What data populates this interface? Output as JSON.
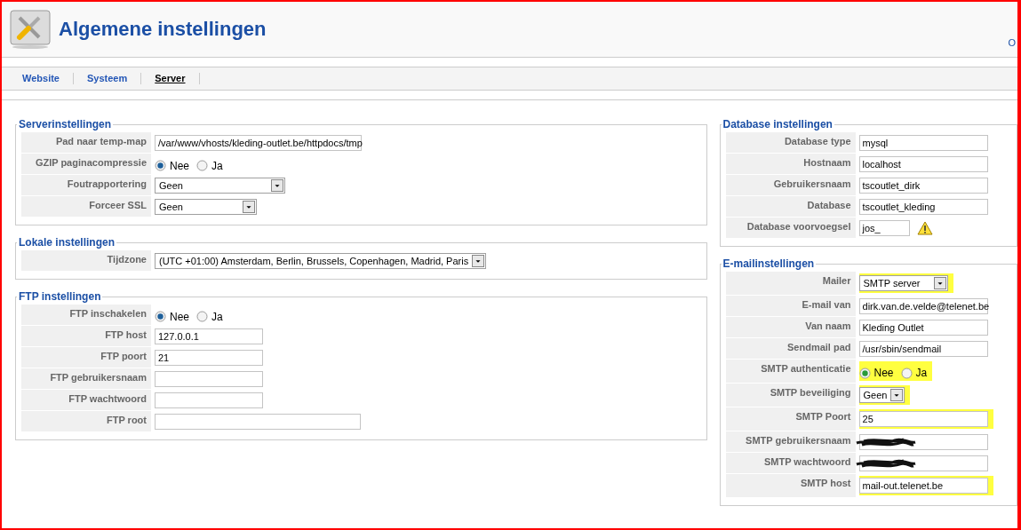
{
  "header": {
    "title": "Algemene instellingen",
    "toolbar_text": "O"
  },
  "tabs": [
    {
      "label": "Website",
      "selected": false
    },
    {
      "label": "Systeem",
      "selected": false
    },
    {
      "label": "Server",
      "selected": true
    }
  ],
  "left_sections": [
    {
      "title": "Serverinstellingen",
      "rows": [
        {
          "label": "Pad naar temp-map",
          "kind": "text",
          "value": "/var/www/vhosts/kleding-outlet.be/httpdocs/tmp"
        },
        {
          "label": "GZIP paginacompressie",
          "kind": "radio",
          "options": [
            {
              "label": "Nee",
              "selected": true
            },
            {
              "label": "Ja",
              "selected": false
            }
          ]
        },
        {
          "label": "Foutrapportering",
          "kind": "select",
          "value": "Geen"
        },
        {
          "label": "Forceer SSL",
          "kind": "select",
          "value": "Geen"
        }
      ]
    },
    {
      "title": "Lokale instellingen",
      "rows": [
        {
          "label": "Tijdzone",
          "kind": "select",
          "value": "(UTC +01:00) Amsterdam, Berlin, Brussels, Copenhagen, Madrid, Paris"
        }
      ]
    },
    {
      "title": "FTP instellingen",
      "rows": [
        {
          "label": "FTP inschakelen",
          "kind": "radio",
          "options": [
            {
              "label": "Nee",
              "selected": true
            },
            {
              "label": "Ja",
              "selected": false
            }
          ]
        },
        {
          "label": "FTP host",
          "kind": "text",
          "value": "127.0.0.1"
        },
        {
          "label": "FTP poort",
          "kind": "text",
          "value": "21"
        },
        {
          "label": "FTP gebruikersnaam",
          "kind": "text"
        },
        {
          "label": "FTP wachtwoord",
          "kind": "text"
        },
        {
          "label": "FTP root",
          "kind": "text"
        }
      ]
    }
  ],
  "right_sections": [
    {
      "title": "Database instellingen",
      "rows": [
        {
          "label": "Database type",
          "kind": "text",
          "value": "mysql"
        },
        {
          "label": "Hostnaam",
          "kind": "text",
          "value": "localhost"
        },
        {
          "label": "Gebruikersnaam",
          "kind": "text",
          "value": "tscoutlet_dirk"
        },
        {
          "label": "Database",
          "kind": "text",
          "value": "tscoutlet_kleding"
        },
        {
          "label": "Database voorvoegsel",
          "kind": "text",
          "value": "jos_",
          "warning": true
        }
      ]
    },
    {
      "title": "E-mailinstellingen",
      "rows": [
        {
          "label": "Mailer",
          "kind": "select",
          "value": "SMTP server",
          "highlighted": true
        },
        {
          "label": "E-mail van",
          "kind": "text",
          "value": "dirk.van.de.velde@telenet.be"
        },
        {
          "label": "Van naam",
          "kind": "text",
          "value": "Kleding Outlet"
        },
        {
          "label": "Sendmail pad",
          "kind": "text",
          "value": "/usr/sbin/sendmail"
        },
        {
          "label": "SMTP authenticatie",
          "kind": "radio",
          "highlighted": true,
          "options": [
            {
              "label": "Nee",
              "selected": true
            },
            {
              "label": "Ja",
              "selected": false
            }
          ]
        },
        {
          "label": "SMTP beveiliging",
          "kind": "select",
          "value": "Geen",
          "highlighted": true
        },
        {
          "label": "SMTP Poort",
          "kind": "text",
          "value": "25",
          "highlighted": true
        },
        {
          "label": "SMTP gebruikersnaam",
          "kind": "text",
          "scribbled": true
        },
        {
          "label": "SMTP wachtwoord",
          "kind": "text",
          "scribbled": true
        },
        {
          "label": "SMTP host",
          "kind": "text",
          "value": "mail-out.telenet.be",
          "highlighted": true
        }
      ]
    }
  ]
}
